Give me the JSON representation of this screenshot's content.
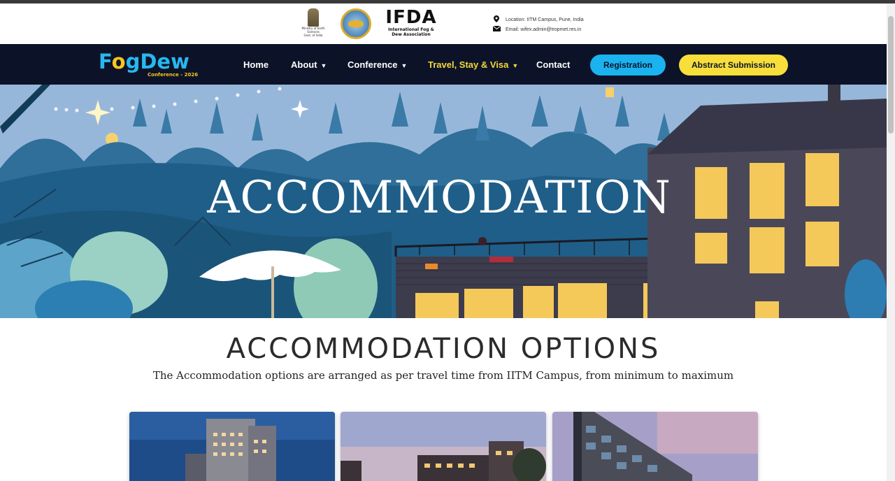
{
  "header": {
    "emblem_text": [
      "Ministry of Earth Sciences",
      "Govt. of India"
    ],
    "org_short": "IFDA",
    "org_full_line1": "International Fog &",
    "org_full_line2": "Dew Association",
    "location": "Location: IITM Campus, Pune, India",
    "email": "Email: wifex.admin@tropmet.res.in",
    "location_icon": "map-pin-icon",
    "email_icon": "envelope-icon"
  },
  "nav": {
    "logo_part1": "F",
    "logo_drop": "o",
    "logo_part2": "gDew",
    "logo_sub": "Conference - 2026",
    "items": [
      {
        "label": "Home",
        "dropdown": false
      },
      {
        "label": "About",
        "dropdown": true
      },
      {
        "label": "Conference",
        "dropdown": true
      },
      {
        "label": "Travel, Stay & Visa",
        "dropdown": true,
        "active": true
      },
      {
        "label": "Contact",
        "dropdown": false
      }
    ],
    "registration_label": "Registration",
    "abstract_label": "Abstract Submission",
    "colors": {
      "nav_bg": "#0c1328",
      "accent_blue": "#1ab3f0",
      "accent_yellow": "#f8de3a"
    }
  },
  "hero": {
    "title": "ACCOMMODATION"
  },
  "section": {
    "title": "ACCOMMODATION OPTIONS",
    "subtitle": "The Accommodation options are arranged as per travel time from IITM Campus, from minimum to maximum"
  }
}
